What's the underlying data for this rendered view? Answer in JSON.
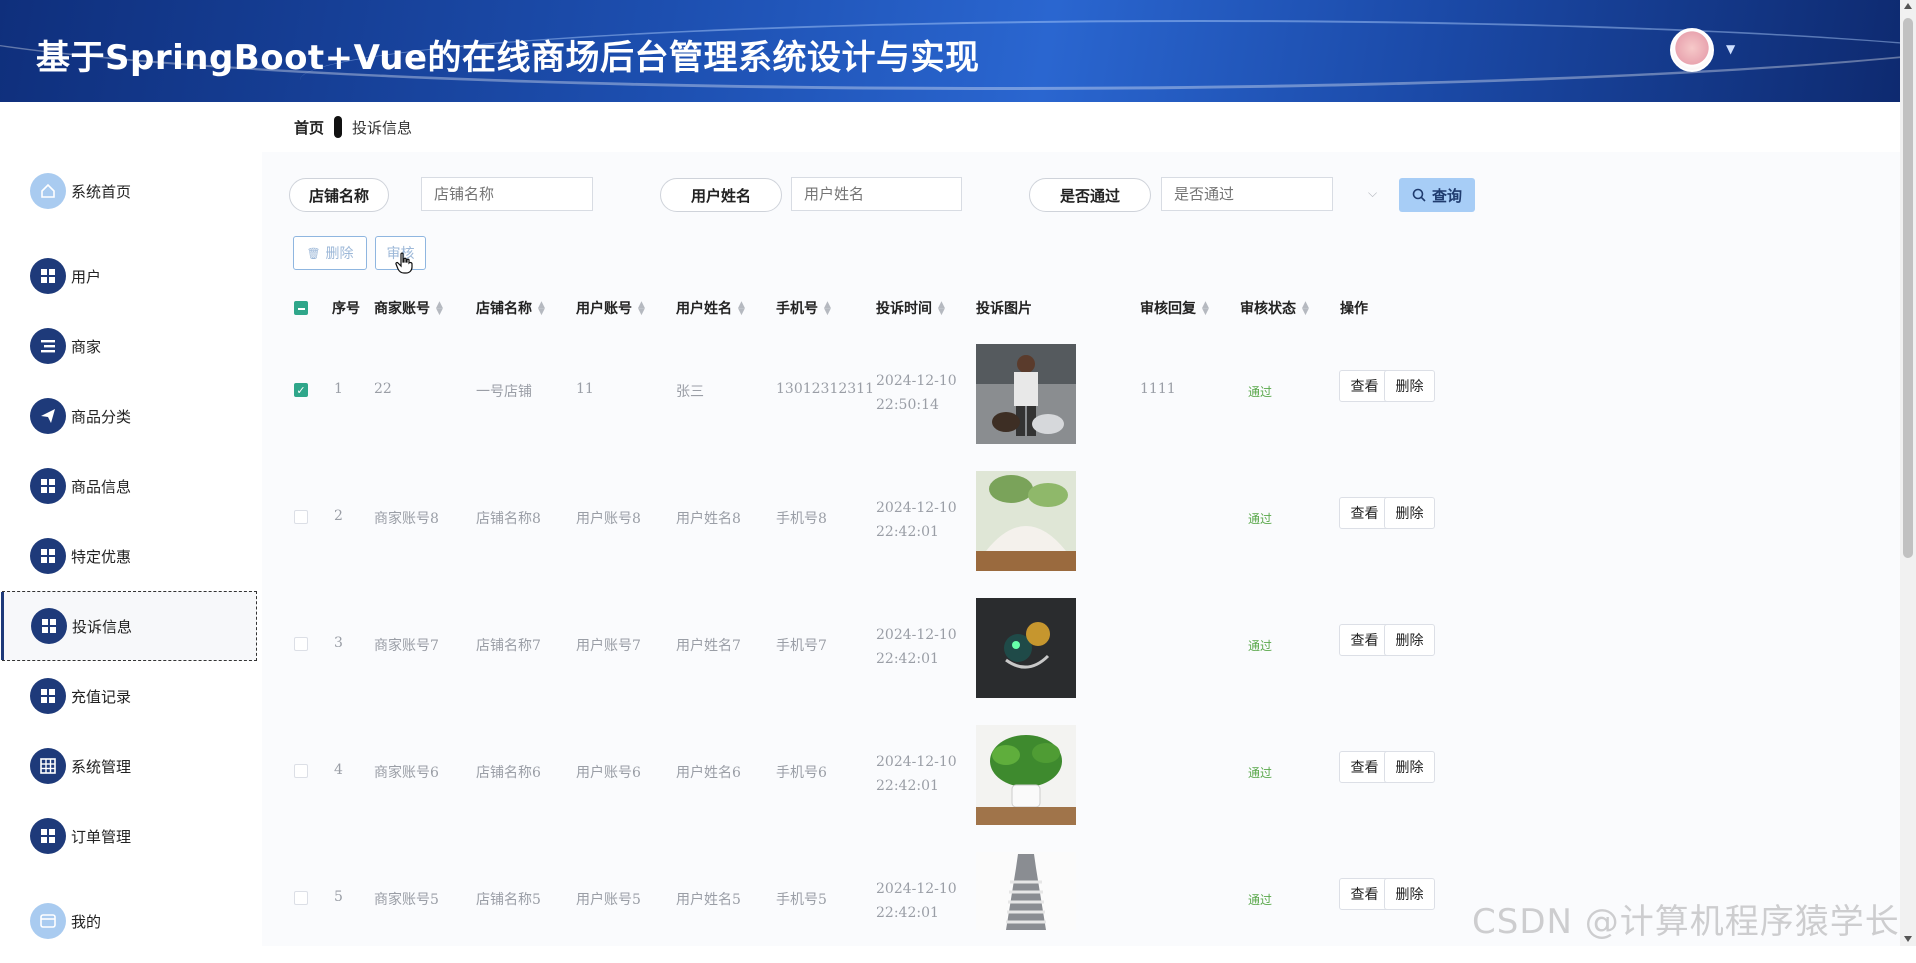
{
  "app": {
    "title": "基于SpringBoot+Vue的在线商场后台管理系统设计与实现"
  },
  "breadcrumb": {
    "home": "首页",
    "current": "投诉信息"
  },
  "sidebar": {
    "items": [
      {
        "label": "系统首页",
        "icon": "home-icon"
      },
      {
        "label": "用户",
        "icon": "grid-icon"
      },
      {
        "label": "商家",
        "icon": "list-icon"
      },
      {
        "label": "商品分类",
        "icon": "send-icon"
      },
      {
        "label": "商品信息",
        "icon": "grid-icon"
      },
      {
        "label": "特定优惠",
        "icon": "grid-icon"
      },
      {
        "label": "投诉信息",
        "icon": "grid-icon"
      },
      {
        "label": "充值记录",
        "icon": "grid-icon"
      },
      {
        "label": "系统管理",
        "icon": "table-icon"
      },
      {
        "label": "订单管理",
        "icon": "grid-icon"
      },
      {
        "label": "我的",
        "icon": "card-icon"
      }
    ]
  },
  "search": {
    "store_label": "店铺名称",
    "store_placeholder": "店铺名称",
    "user_label": "用户姓名",
    "user_placeholder": "用户姓名",
    "pass_label": "是否通过",
    "pass_placeholder": "是否通过",
    "query_label": "查询"
  },
  "toolbar": {
    "delete_label": "删除",
    "review_label": "审核"
  },
  "table": {
    "headers": {
      "index": "序号",
      "merchant": "商家账号",
      "store": "店铺名称",
      "account": "用户账号",
      "username": "用户姓名",
      "phone": "手机号",
      "time": "投诉时间",
      "image": "投诉图片",
      "reply": "审核回复",
      "status": "审核状态",
      "action": "操作"
    },
    "rows": [
      {
        "index": "1",
        "merchant": "22",
        "store": "一号店铺",
        "account": "11",
        "username": "张三",
        "phone": "13012312311",
        "time": "2024-12-10 22:50:14",
        "reply": "1111",
        "status": "通过",
        "checked": true
      },
      {
        "index": "2",
        "merchant": "商家账号8",
        "store": "店铺名称8",
        "account": "用户账号8",
        "username": "用户姓名8",
        "phone": "手机号8",
        "time": "2024-12-10 22:42:01",
        "reply": "",
        "status": "通过",
        "checked": false
      },
      {
        "index": "3",
        "merchant": "商家账号7",
        "store": "店铺名称7",
        "account": "用户账号7",
        "username": "用户姓名7",
        "phone": "手机号7",
        "time": "2024-12-10 22:42:01",
        "reply": "",
        "status": "通过",
        "checked": false
      },
      {
        "index": "4",
        "merchant": "商家账号6",
        "store": "店铺名称6",
        "account": "用户账号6",
        "username": "用户姓名6",
        "phone": "手机号6",
        "time": "2024-12-10 22:42:01",
        "reply": "",
        "status": "通过",
        "checked": false
      },
      {
        "index": "5",
        "merchant": "商家账号5",
        "store": "店铺名称5",
        "account": "用户账号5",
        "username": "用户姓名5",
        "phone": "手机号5",
        "time": "2024-12-10 22:42:01",
        "reply": "",
        "status": "通过",
        "checked": false
      }
    ],
    "view_label": "查看",
    "delete_label": "删除"
  },
  "watermark": "CSDN @计算机程序猿学长",
  "colors": {
    "header": "#1d4fb0",
    "nav_icon": "#1e3a7a",
    "status_pass": "#5aa84b",
    "query_btn": "#a7cdf6"
  }
}
